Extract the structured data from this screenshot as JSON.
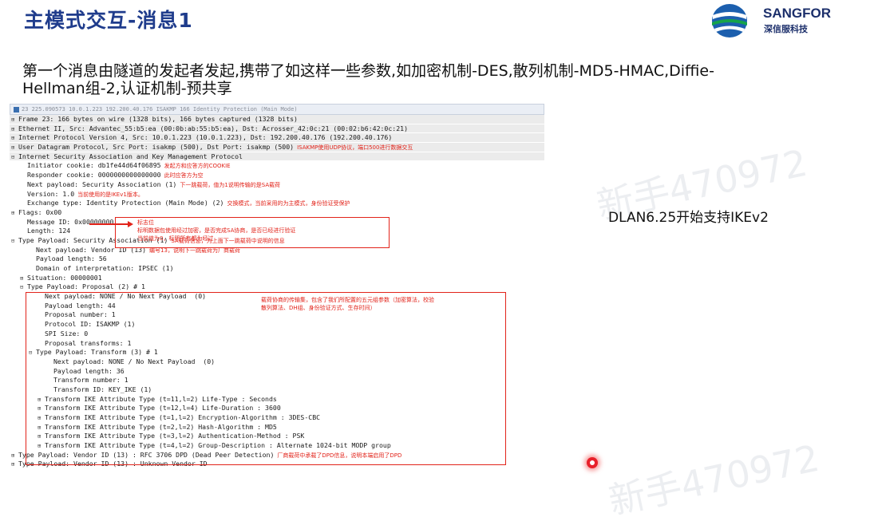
{
  "slide": {
    "title": "主模式交互-消息1",
    "description": "第一个消息由隧道的发起者发起,携带了如这样一些参数,如加密机制-DES,散列机制-MD5-HMAC,Diffie-Hellman组-2,认证机制-预共享",
    "side_note": "DLAN6.25开始支持IKEv2",
    "watermarks": [
      "新手470972",
      "新手470972",
      "新手470972"
    ]
  },
  "logo": {
    "name": "SANGFOR",
    "subtitle": "深信服科技",
    "colors": [
      "#1c5fae",
      "#16a34a"
    ]
  },
  "colors": {
    "title": "#1f3c8c",
    "annotation": "#e2231a"
  },
  "packet_header": "23 225.090573 10.0.1.223 192.200.40.176 ISAKMP 166 Identity Protection (Main Mode)",
  "packet_lines": [
    {
      "text": "Frame 23: 166 bytes on wire (1328 bits), 166 bytes captured (1328 bits)",
      "indent": 0,
      "toggle": "⊞",
      "gray": true,
      "note": ""
    },
    {
      "text": "Ethernet II, Src: Advantec_55:b5:ea (00:0b:ab:55:b5:ea), Dst: Acrosser_42:0c:21 (00:02:b6:42:0c:21)",
      "indent": 0,
      "toggle": "⊞",
      "gray": true,
      "note": ""
    },
    {
      "text": "Internet Protocol Version 4, Src: 10.0.1.223 (10.0.1.223), Dst: 192.200.40.176 (192.200.40.176)",
      "indent": 0,
      "toggle": "⊞",
      "gray": true,
      "note": ""
    },
    {
      "text": "User Datagram Protocol, Src Port: isakmp (500), Dst Port: isakmp (500)",
      "indent": 0,
      "toggle": "⊞",
      "gray": true,
      "note": "ISAKMP使用UDP协议，端口500进行数据交互"
    },
    {
      "text": "Internet Security Association and Key Management Protocol",
      "indent": 0,
      "toggle": "⊟",
      "gray": true,
      "note": ""
    },
    {
      "text": "Initiator cookie: db1fe44d64f06895",
      "indent": 1,
      "toggle": "",
      "gray": false,
      "note": "发起方和应答方的COOKIE"
    },
    {
      "text": "Responder cookie: 0000000000000000",
      "indent": 1,
      "toggle": "",
      "gray": false,
      "note": "此时应答方为空"
    },
    {
      "text": "Next payload: Security Association (1)",
      "indent": 1,
      "toggle": "",
      "gray": false,
      "note": "下一跳载荷，值为1说明传输的是SA载荷"
    },
    {
      "text": "Version: 1.0",
      "indent": 1,
      "toggle": "",
      "gray": false,
      "note": "当前使用的是IKEv1版本。"
    },
    {
      "text": "Exchange type: Identity Protection (Main Mode) (2)",
      "indent": 1,
      "toggle": "",
      "gray": false,
      "note": "交换模式，当前采用的为主模式，身份验证受保护"
    },
    {
      "text": "Flags: 0x00",
      "indent": 0,
      "toggle": "⊞",
      "gray": false,
      "note": ""
    },
    {
      "text": "Message ID: 0x00000000",
      "indent": 1,
      "toggle": "",
      "gray": false,
      "note": ""
    },
    {
      "text": "Length: 124",
      "indent": 1,
      "toggle": "",
      "gray": false,
      "note": ""
    },
    {
      "text": "Type Payload: Security Association (1)",
      "indent": 0,
      "toggle": "⊟",
      "gray": false,
      "note": "SA载荷信息，为上面下一跳载荷中说明的信息"
    },
    {
      "text": "Next payload: Vendor ID (13)",
      "indent": 2,
      "toggle": "",
      "gray": false,
      "note": "编号13，说明下一跳载荷为厂商载荷"
    },
    {
      "text": "Payload length: 56",
      "indent": 2,
      "toggle": "",
      "gray": false,
      "note": ""
    },
    {
      "text": "Domain of interpretation: IPSEC (1)",
      "indent": 2,
      "toggle": "",
      "gray": false,
      "note": ""
    },
    {
      "text": "Situation: 00000001",
      "indent": 1,
      "toggle": "⊞",
      "gray": false,
      "note": ""
    },
    {
      "text": "Type Payload: Proposal (2) # 1",
      "indent": 1,
      "toggle": "⊟",
      "gray": false,
      "note": ""
    },
    {
      "text": "Next payload: NONE / No Next Payload  (0)",
      "indent": 3,
      "toggle": "",
      "gray": false,
      "note": ""
    },
    {
      "text": "Payload length: 44",
      "indent": 3,
      "toggle": "",
      "gray": false,
      "note": ""
    },
    {
      "text": "Proposal number: 1",
      "indent": 3,
      "toggle": "",
      "gray": false,
      "note": ""
    },
    {
      "text": "Protocol ID: ISAKMP (1)",
      "indent": 3,
      "toggle": "",
      "gray": false,
      "note": ""
    },
    {
      "text": "SPI Size: 0",
      "indent": 3,
      "toggle": "",
      "gray": false,
      "note": ""
    },
    {
      "text": "Proposal transforms: 1",
      "indent": 3,
      "toggle": "",
      "gray": false,
      "note": ""
    },
    {
      "text": "Type Payload: Transform (3) # 1",
      "indent": 2,
      "toggle": "⊟",
      "gray": false,
      "note": ""
    },
    {
      "text": "Next payload: NONE / No Next Payload  (0)",
      "indent": 4,
      "toggle": "",
      "gray": false,
      "note": ""
    },
    {
      "text": "Payload length: 36",
      "indent": 4,
      "toggle": "",
      "gray": false,
      "note": ""
    },
    {
      "text": "Transform number: 1",
      "indent": 4,
      "toggle": "",
      "gray": false,
      "note": ""
    },
    {
      "text": "Transform ID: KEY_IKE (1)",
      "indent": 4,
      "toggle": "",
      "gray": false,
      "note": ""
    },
    {
      "text": "Transform IKE Attribute Type (t=11,l=2) Life-Type : Seconds",
      "indent": 3,
      "toggle": "⊞",
      "gray": false,
      "note": ""
    },
    {
      "text": "Transform IKE Attribute Type (t=12,l=4) Life-Duration : 3600",
      "indent": 3,
      "toggle": "⊞",
      "gray": false,
      "note": ""
    },
    {
      "text": "Transform IKE Attribute Type (t=1,l=2) Encryption-Algorithm : 3DES-CBC",
      "indent": 3,
      "toggle": "⊞",
      "gray": false,
      "note": ""
    },
    {
      "text": "Transform IKE Attribute Type (t=2,l=2) Hash-Algorithm : MD5",
      "indent": 3,
      "toggle": "⊞",
      "gray": false,
      "note": ""
    },
    {
      "text": "Transform IKE Attribute Type (t=3,l=2) Authentication-Method : PSK",
      "indent": 3,
      "toggle": "⊞",
      "gray": false,
      "note": ""
    },
    {
      "text": "Transform IKE Attribute Type (t=4,l=2) Group-Description : Alternate 1024-bit MODP group",
      "indent": 3,
      "toggle": "⊞",
      "gray": false,
      "note": ""
    },
    {
      "text": "Type Payload: Vendor ID (13) : RFC 3706 DPD (Dead Peer Detection)",
      "indent": 0,
      "toggle": "⊞",
      "gray": false,
      "note": "厂商载荷中承载了DPD信息，说明本端启用了DPD"
    },
    {
      "text": "Type Payload: Vendor ID (13) : Unknown Vendor ID",
      "indent": 0,
      "toggle": "⊞",
      "gray": false,
      "note": ""
    }
  ],
  "flags_annotation": [
    "标志位",
    "标明数据包使用经过加密，是否完成SA协商，是否已经进行验证",
    "当前值为0，标明所有都为经过"
  ],
  "proposal_annotation": [
    "载荷协商的传输集，包含了我们所配置的五元组参数（加密算法，校验",
    "散列算法、DH组、身份验证方式、生存时间）"
  ]
}
